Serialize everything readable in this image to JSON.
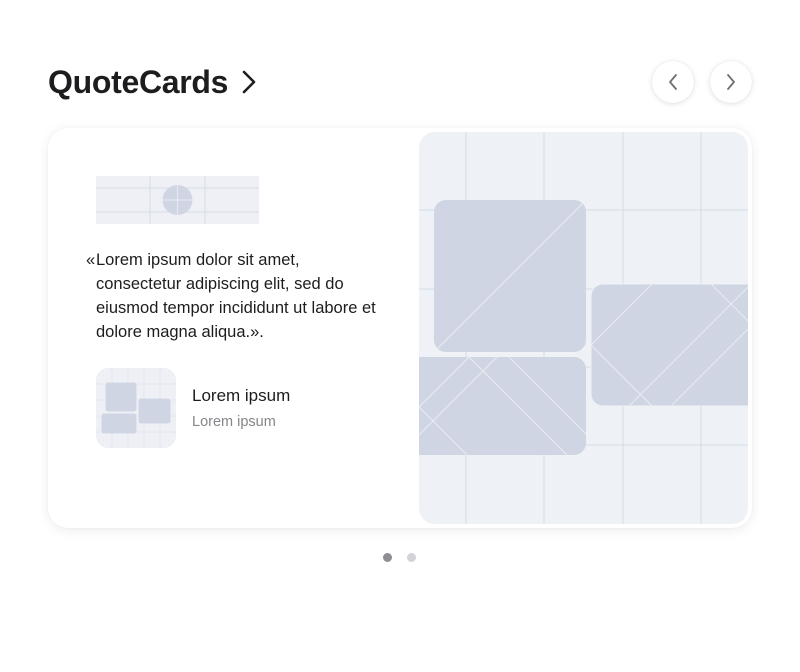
{
  "header": {
    "title": "QuoteCards",
    "title_icon": "chevron-right-icon",
    "prev_icon": "chevron-left-icon",
    "next_icon": "chevron-right-icon"
  },
  "card": {
    "logo_icon": "logo-placeholder-icon",
    "quote": {
      "open_mark": "«",
      "text": "Lorem ipsum dolor sit amet, consectetur adipiscing elit, sed do eiusmod tempor incididunt ut labore et dolore magna aliqua.»."
    },
    "person": {
      "avatar_icon": "avatar-placeholder-icon",
      "name": "Lorem ipsum",
      "role": "Lorem ipsum"
    },
    "illustration_icon": "image-placeholder-icon"
  },
  "pagination": {
    "total": 2,
    "active": 1
  },
  "colors": {
    "placeholder_bg": "#eef1f6",
    "placeholder_shape": "#cfd5e2",
    "active_dot": "#8e8e93",
    "inactive_dot": "#d2d2d7"
  }
}
